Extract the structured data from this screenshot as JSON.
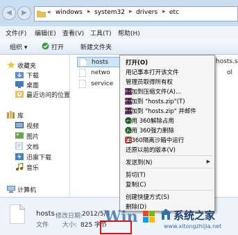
{
  "address": {
    "overflow": "«",
    "segments": [
      "windows",
      "system32",
      "drivers",
      "etc"
    ]
  },
  "menu": [
    "文件(F)",
    "编辑(E)",
    "查看(V)",
    "工具(T)",
    "帮助(H)"
  ],
  "toolbar": {
    "organize": "组织 ▾",
    "open": "打开",
    "new_folder": "新建文件夹"
  },
  "nav": {
    "favorites": "收藏夹",
    "favorites_items": [
      "下载",
      "桌面",
      "最近访问的位置"
    ],
    "libraries": "库",
    "library_items": [
      "视频",
      "图片",
      "文档",
      "迅雷下载",
      "音乐"
    ],
    "computer": "计算机"
  },
  "files": [
    {
      "name": "hosts",
      "extra": "hosts.sam"
    },
    {
      "name": "netwo",
      "extra": "ol"
    },
    {
      "name": "service",
      "extra": ""
    }
  ],
  "details": {
    "filename": "hosts",
    "modified_label": "修改日期:",
    "modified_value": "2012/5/3",
    "type": "文件",
    "size_label": "大小:",
    "size_value": "825 字节"
  },
  "context_menu": {
    "open": "打开(O)",
    "open_notepad": "用记事本打开该文件",
    "take_ownership": "管理员取得所有权",
    "add_archive": "添加到压缩文件(A)...",
    "add_hosts_zip": "添加到 \"hosts.zip\"(T)",
    "add_hosts_zip_email": "添加到 \"hosts.zip\" 并邮件",
    "unzip_360": "使用 360解除占用",
    "delete_360": "使用 360强力删除",
    "sandbox_360": "在360隔离沙箱中运行",
    "restore": "还原以前的版本(V)",
    "send_to": "发送到(N)",
    "cut": "剪切(T)",
    "copy": "复制(C)",
    "create_shortcut": "创建快捷方式(S)",
    "delete": "删除(D)"
  },
  "watermark": {
    "brand": "系统之家",
    "url": "www.xitongzhijia.net"
  },
  "colors": {
    "frame": "#c9dcf0",
    "accent_red": "#e01010"
  }
}
